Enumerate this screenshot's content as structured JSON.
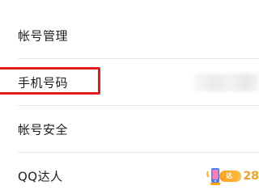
{
  "settings": {
    "rows": [
      {
        "label": "帐号管理"
      },
      {
        "label": "手机号码"
      },
      {
        "label": "帐号安全"
      },
      {
        "label": "QQ达人"
      }
    ],
    "qq_master_badge": {
      "icon": "phone-badge-icon",
      "pill_text": "达人",
      "count_text": "28"
    }
  },
  "colors": {
    "highlight": "#e01d1d",
    "badge_orange": "#ff9a1f"
  }
}
